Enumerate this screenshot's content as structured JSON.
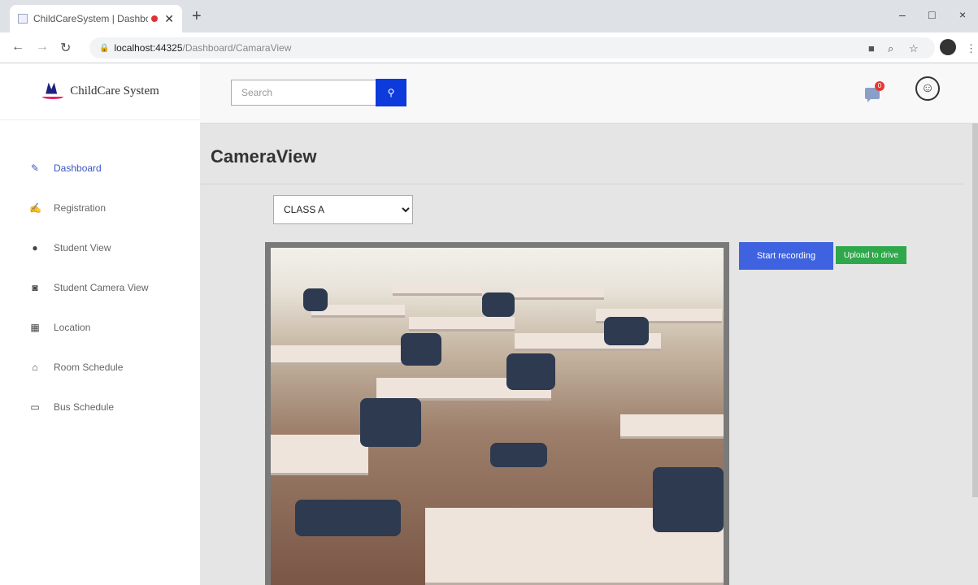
{
  "browser": {
    "tab_title": "ChildCareSystem | Dashboa",
    "new_tab_label": "+",
    "url_host": "localhost:44325",
    "url_path": "/Dashboard/CamaraView",
    "minimize_label": "–",
    "restore_label": "□",
    "close_label": "×"
  },
  "brand": {
    "name": "ChildCare System"
  },
  "search": {
    "placeholder": "Search"
  },
  "notifications": {
    "count": "0"
  },
  "sidebar": {
    "items": [
      {
        "label": "Dashboard",
        "icon": "edit-icon"
      },
      {
        "label": "Registration",
        "icon": "register-icon"
      },
      {
        "label": "Student View",
        "icon": "user-icon"
      },
      {
        "label": "Student Camera View",
        "icon": "camera-icon"
      },
      {
        "label": "Location",
        "icon": "map-icon"
      },
      {
        "label": "Room Schedule",
        "icon": "home-icon"
      },
      {
        "label": "Bus Schedule",
        "icon": "bus-icon"
      }
    ]
  },
  "main": {
    "title": "CameraView",
    "class_select": {
      "selected": "CLASS A"
    },
    "start_recording_label": "Start recording",
    "upload_label": "Upload to drive"
  },
  "colors": {
    "accent": "#0d3adb",
    "start_btn": "#3f63e0",
    "upload_btn": "#2ea84b",
    "active_nav": "#3a57c4"
  }
}
